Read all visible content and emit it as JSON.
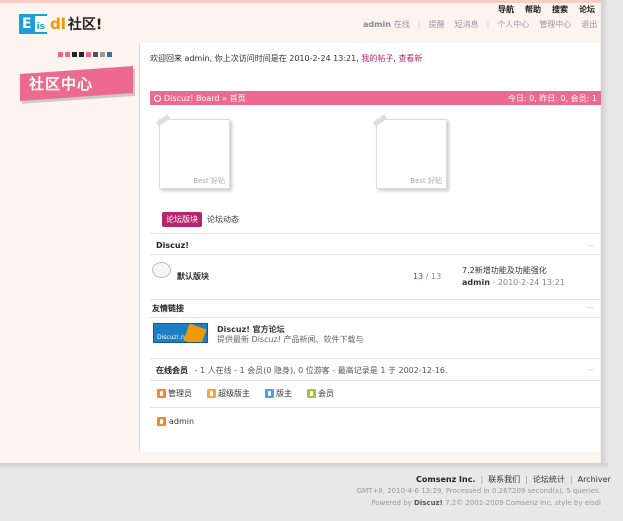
{
  "logo": {
    "e": "E",
    "is": "is",
    "dl": "dl",
    "cn": "社区!"
  },
  "topnav": [
    "导航",
    "帮助",
    "搜索",
    "论坛"
  ],
  "usernav": {
    "username": "admin",
    "online": "在线",
    "items": [
      "提醒",
      "短消息",
      "个人中心",
      "管理中心",
      "退出"
    ]
  },
  "banner": "社区中心",
  "dot_colors": [
    "#ec6a8d",
    "#ec6a8d",
    "#222222",
    "#222222",
    "#ec6a8d",
    "#555555",
    "#999999",
    "#3d6e8a"
  ],
  "welcome": {
    "text": "欢迎回来  admin, 你上次访问时间是在  2010-2-24 13:21,",
    "my_posts": "我的帖子",
    "see_new": "查看新"
  },
  "bar": {
    "crumb": "Discuz! Board » 首页",
    "stats": "今日: 0, 昨日: 0, 会员: 1"
  },
  "cards": [
    "Best 好贴",
    "Best 好贴"
  ],
  "tabs": {
    "active": "论坛版块",
    "other": "论坛动态"
  },
  "category": {
    "title": "Discuz!",
    "collapse": "—"
  },
  "forum": {
    "name": "默认版块",
    "threads": "13",
    "divider": "/",
    "posts": "13",
    "last_title": "7.2新增功能及功能强化",
    "last_user": "admin",
    "last_time": "- 2010-2-24 13:21"
  },
  "links_section": {
    "title": "友情链接",
    "logo_text": "Discuz!.net",
    "name": "Discuz! 官方论坛",
    "desc": "提供最新  Discuz! 产品新闻、软件下载与"
  },
  "online": {
    "title": "在线会员",
    "text": "- 1 人在线  - 1 会员(0 隐身), 0 位游客  - 最高记录是  1 于  2002-12-16."
  },
  "legend": [
    {
      "label": "管理员",
      "color": "#f08a2a"
    },
    {
      "label": "超级版主",
      "color": "#f2a93b"
    },
    {
      "label": "版主",
      "color": "#45a8d8"
    },
    {
      "label": "会员",
      "color": "#a6c43a"
    }
  ],
  "online_user": {
    "name": "admin",
    "color": "#f08a2a"
  },
  "footer": {
    "company": "Comsenz Inc.",
    "links": [
      "联系我们",
      "论坛统计",
      "Archiver"
    ],
    "meta": "GMT+8, 2010-4-6 13:29, Processed in 0.267209 second(s), 5 queries.",
    "power_prefix": "Powered by",
    "power_brand": "Discuz!",
    "power_suffix": "7.2© 2001-2009 Comsenz Inc. style by eisdl"
  }
}
